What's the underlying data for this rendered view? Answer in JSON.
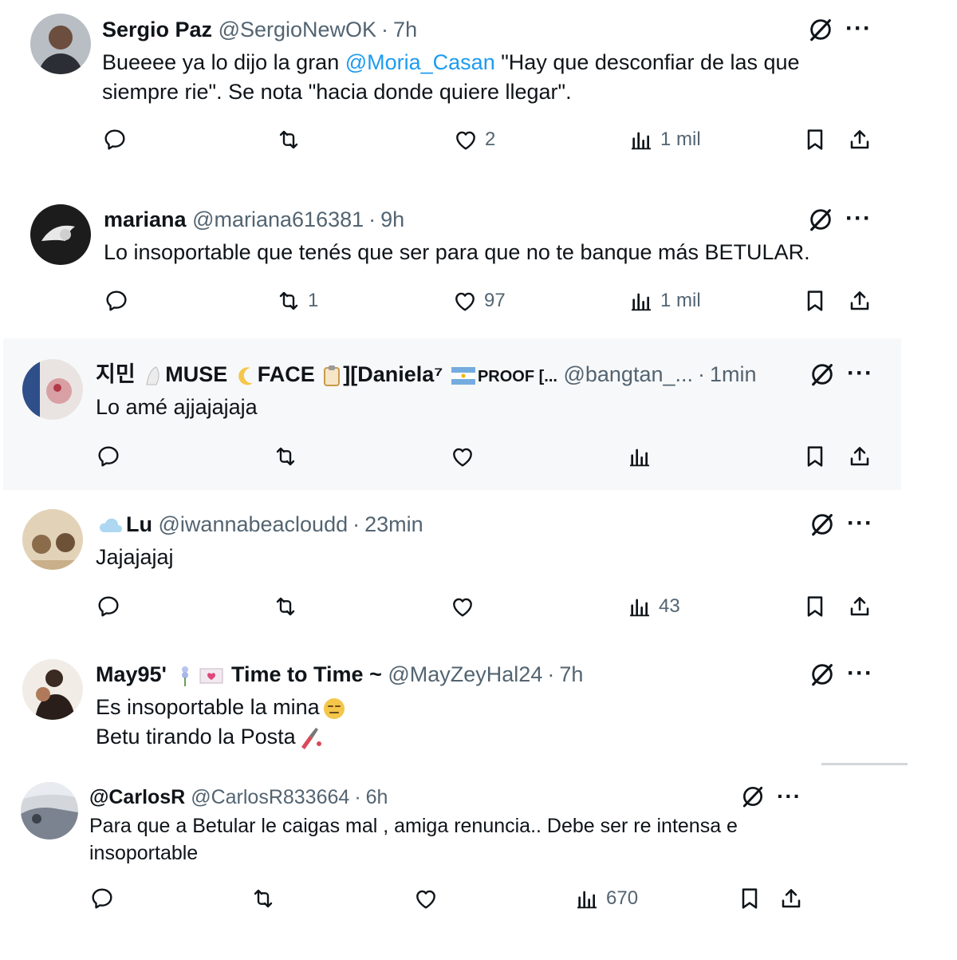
{
  "posts": [
    {
      "name": "Sergio Paz",
      "handle": "@SergioNewOK",
      "time": "7h",
      "text_before": "Bueeee ya lo dijo la gran ",
      "mention": "@Moria_Casan",
      "text_after": " \"Hay que desconfiar de las que siempre rie\". Se nota \"hacia donde quiere llegar\".",
      "replies": "",
      "reposts": "",
      "likes": "2",
      "views": "1 mil"
    },
    {
      "name": "mariana",
      "handle": "@mariana616381",
      "time": "9h",
      "text": "Lo insoportable que tenés que ser para que no te banque más BETULAR.",
      "replies": "",
      "reposts": "1",
      "likes": "97",
      "views": "1 mil"
    },
    {
      "name_a": "지민",
      "name_b": "MUSE",
      "name_c": "FACE",
      "name_d": "][Daniela⁷",
      "name_e": "PROOF [...",
      "handle": "@bangtan_...",
      "time": "1min",
      "text": "Lo amé ajjajajaja",
      "replies": "",
      "reposts": "",
      "likes": "",
      "views": ""
    },
    {
      "name": "Lu",
      "handle": "@iwannabeacloudd",
      "time": "23min",
      "text": "Jajajajaj",
      "replies": "",
      "reposts": "",
      "likes": "",
      "views": "43"
    },
    {
      "name_a": "May95'",
      "name_b": "Time to Time ~",
      "handle": "@MayZeyHal24",
      "time": "7h",
      "line1": "Es insoportable la mina",
      "line2": "Betu tirando la Posta"
    },
    {
      "name": "@CarlosR",
      "handle": "@CarlosR833664",
      "time": "6h",
      "text": "Para que a Betular le caigas mal , amiga renuncia.. Debe ser re intensa e insoportable",
      "replies": "",
      "reposts": "",
      "likes": "",
      "views": "670"
    }
  ],
  "more_glyph": "···",
  "separator_dot": "·",
  "icons": [
    "reply-icon",
    "repost-icon",
    "like-icon",
    "views-icon",
    "bookmark-icon",
    "share-icon",
    "grok-icon",
    "more-icon"
  ],
  "colors": {
    "mention": "#1d9bf0",
    "secondary": "#536471",
    "text": "#0f1419"
  }
}
